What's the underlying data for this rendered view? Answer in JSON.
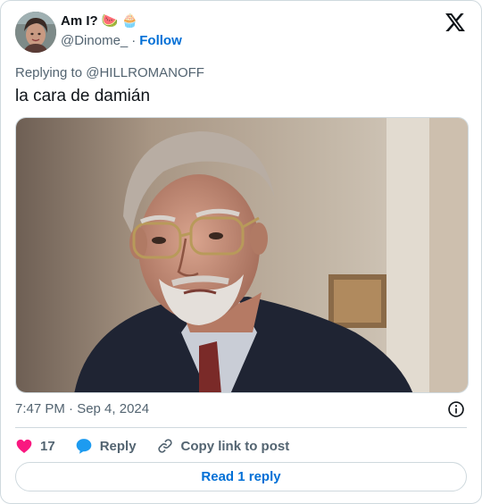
{
  "author": {
    "display_name": "Am I?",
    "emojis": [
      "🍉",
      "🧁"
    ],
    "handle": "@Dinome_",
    "separator": "·",
    "follow_label": "Follow"
  },
  "replying_to": {
    "prefix": "Replying to ",
    "mention": "@HILLROMANOFF"
  },
  "tweet": {
    "text": "la cara de damián",
    "timestamp": "7:47 PM · Sep 4, 2024"
  },
  "actions": {
    "like_count": "17",
    "reply_label": "Reply",
    "copy_label": "Copy link to post"
  },
  "read_replies_label": "Read 1 reply",
  "colors": {
    "accent": "#006fd6",
    "like": "#f91880",
    "reply_bubble": "#1d9bf0",
    "muted": "#536471",
    "border": "#cfd9de"
  },
  "icons": {
    "brand": "x-logo-icon",
    "info": "info-icon",
    "like": "heart-icon",
    "reply": "chat-bubble-icon",
    "copy": "link-icon"
  }
}
